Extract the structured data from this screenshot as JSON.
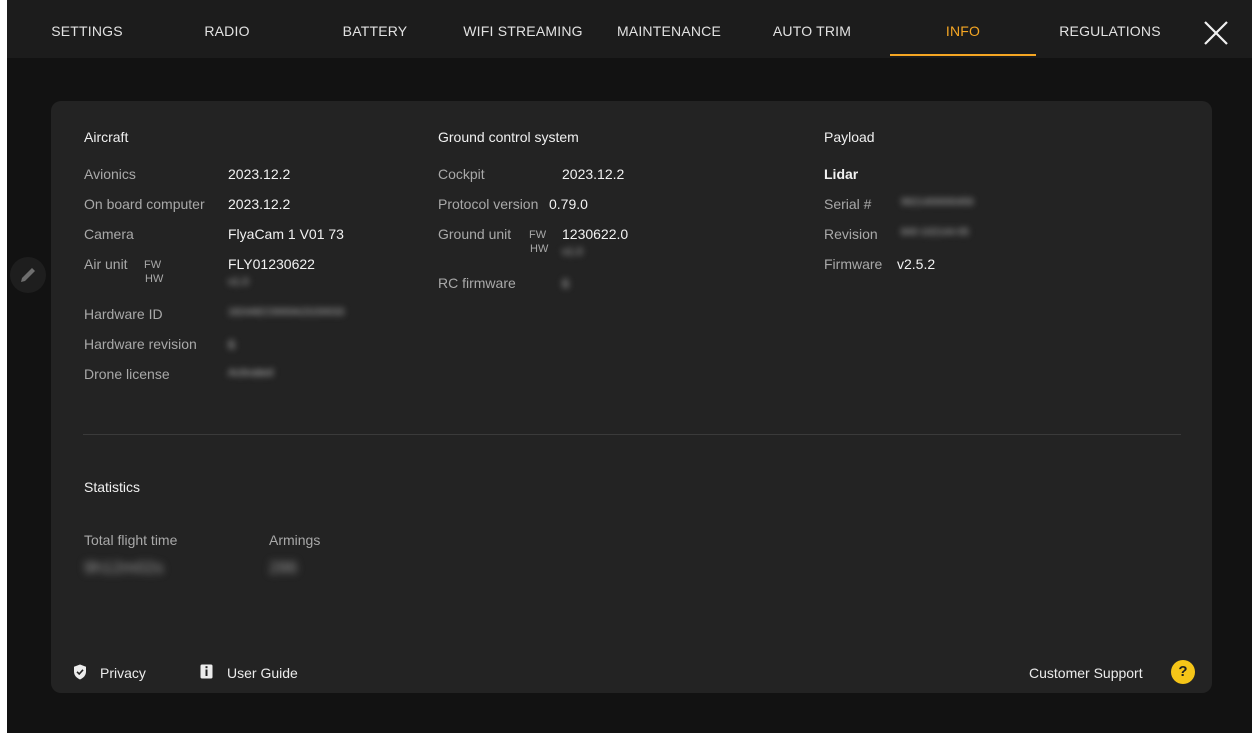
{
  "tabs": [
    {
      "label": "SETTINGS"
    },
    {
      "label": "RADIO"
    },
    {
      "label": "BATTERY"
    },
    {
      "label": "WIFI STREAMING"
    },
    {
      "label": "MAINTENANCE"
    },
    {
      "label": "AUTO TRIM"
    },
    {
      "label": "INFO",
      "active": true
    },
    {
      "label": "REGULATIONS"
    }
  ],
  "accent_color": "#f5a623",
  "aircraft": {
    "title": "Aircraft",
    "avionics_label": "Avionics",
    "avionics_value": "2023.12.2",
    "obc_label": "On board computer",
    "obc_value": "2023.12.2",
    "camera_label": "Camera",
    "camera_value": "FlyaCam 1 V01 73",
    "air_unit_label": "Air unit",
    "fw_label": "FW",
    "hw_label": "HW",
    "air_unit_fw": "FLY01230622",
    "air_unit_hw": "v1.0",
    "hardware_id_label": "Hardware ID",
    "hardware_id_value": "1824AEC0000A23150033",
    "hardware_revision_label": "Hardware revision",
    "hardware_revision_value": "6",
    "drone_license_label": "Drone license",
    "drone_license_value": "Activated"
  },
  "ground": {
    "title": "Ground control system",
    "cockpit_label": "Cockpit",
    "cockpit_value": "2023.12.2",
    "protocol_label": "Protocol version",
    "protocol_value": "0.79.0",
    "ground_unit_label": "Ground unit",
    "fw_label": "FW",
    "hw_label": "HW",
    "ground_unit_fw": "1230622.0",
    "ground_unit_hw": "v1.0",
    "rc_label": "RC firmware",
    "rc_value": "6"
  },
  "payload": {
    "title": "Payload",
    "name": "Lidar",
    "serial_label": "Serial #",
    "serial_value": "9921400000459",
    "revision_label": "Revision",
    "revision_value": "840-102144-05",
    "firmware_label": "Firmware",
    "firmware_value": "v2.5.2"
  },
  "statistics": {
    "title": "Statistics",
    "flight_time_label": "Total flight time",
    "flight_time_value": "9h12m02s",
    "armings_label": "Armings",
    "armings_value": "286"
  },
  "footer": {
    "privacy": "Privacy",
    "user_guide": "User Guide",
    "support": "Customer Support",
    "help_glyph": "?"
  },
  "icons": {
    "close": "close-icon",
    "edit": "pencil-icon",
    "privacy": "shield-icon",
    "guide": "info-book-icon",
    "help": "question-icon"
  }
}
